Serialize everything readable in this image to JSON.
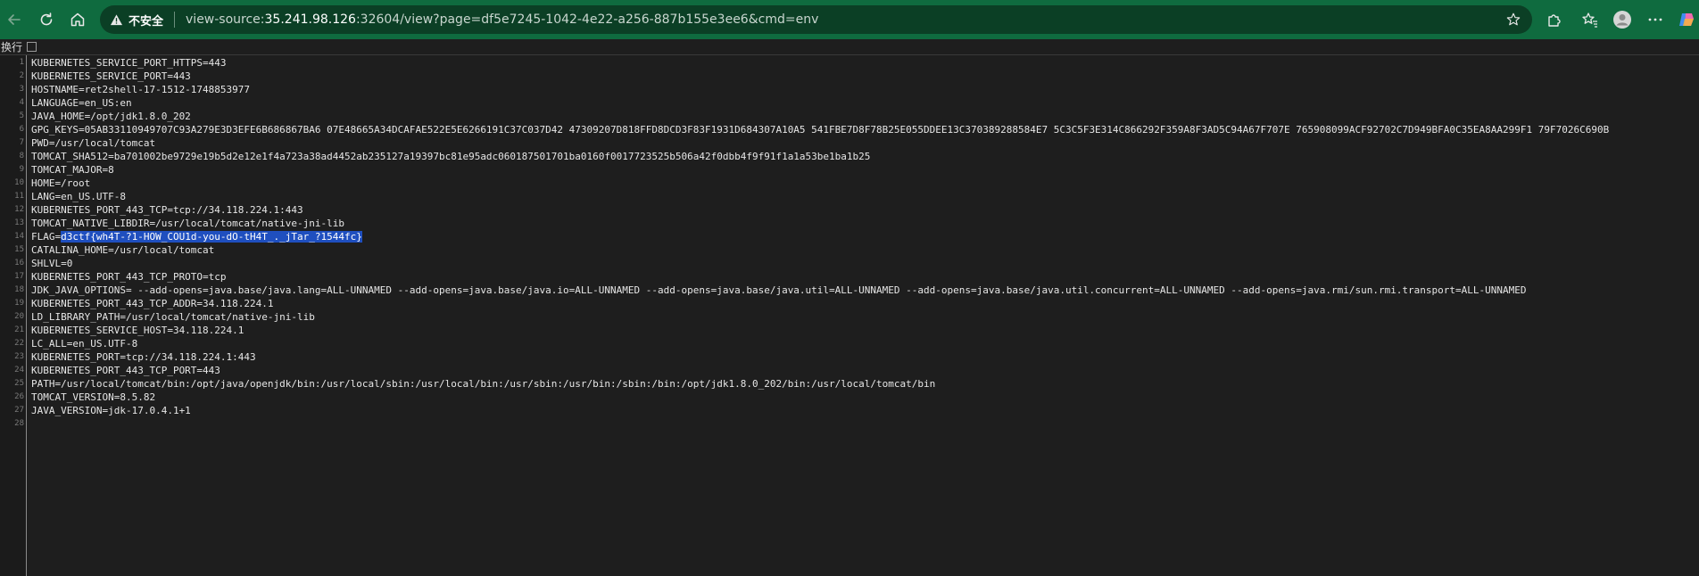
{
  "browser": {
    "insecure_label": "不安全",
    "url_prefix": "view-source:",
    "url_host": "35.241.98.126",
    "url_rest": ":32604/view?page=df5e7245-1042-4e22-a256-887b155e3ee6&cmd=env"
  },
  "wrap": {
    "label": "换行",
    "checked": false
  },
  "lines": [
    {
      "n": "1",
      "text": "KUBERNETES_SERVICE_PORT_HTTPS=443"
    },
    {
      "n": "2",
      "text": "KUBERNETES_SERVICE_PORT=443"
    },
    {
      "n": "3",
      "text": "HOSTNAME=ret2shell-17-1512-1748853977"
    },
    {
      "n": "4",
      "text": "LANGUAGE=en_US:en"
    },
    {
      "n": "5",
      "text": "JAVA_HOME=/opt/jdk1.8.0_202"
    },
    {
      "n": "6",
      "text": "GPG_KEYS=05AB33110949707C93A279E3D3EFE6B686867BA6 07E48665A34DCAFAE522E5E6266191C37C037D42 47309207D818FFD8DCD3F83F1931D684307A10A5 541FBE7D8F78B25E055DDEE13C370389288584E7 5C3C5F3E314C866292F359A8F3AD5C94A67F707E 765908099ACF92702C7D949BFA0C35EA8AA299F1 79F7026C690B"
    },
    {
      "n": "7",
      "text": "PWD=/usr/local/tomcat"
    },
    {
      "n": "8",
      "text": "TOMCAT_SHA512=ba701002be9729e19b5d2e12e1f4a723a38ad4452ab235127a19397bc81e95adc060187501701ba0160f0017723525b506a42f0dbb4f9f91f1a1a53be1ba1b25"
    },
    {
      "n": "9",
      "text": "TOMCAT_MAJOR=8"
    },
    {
      "n": "10",
      "text": "HOME=/root"
    },
    {
      "n": "11",
      "text": "LANG=en_US.UTF-8"
    },
    {
      "n": "12",
      "text": "KUBERNETES_PORT_443_TCP=tcp://34.118.224.1:443"
    },
    {
      "n": "13",
      "text": "TOMCAT_NATIVE_LIBDIR=/usr/local/tomcat/native-jni-lib"
    },
    {
      "n": "14",
      "text": "FLAG=",
      "highlight": "d3ctf{wh4T-?1-HOW_COU1d-you-dO-tH4T_._jTar_?1544fc}"
    },
    {
      "n": "15",
      "text": "CATALINA_HOME=/usr/local/tomcat"
    },
    {
      "n": "16",
      "text": "SHLVL=0"
    },
    {
      "n": "17",
      "text": "KUBERNETES_PORT_443_TCP_PROTO=tcp"
    },
    {
      "n": "18",
      "text": "JDK_JAVA_OPTIONS= --add-opens=java.base/java.lang=ALL-UNNAMED --add-opens=java.base/java.io=ALL-UNNAMED --add-opens=java.base/java.util=ALL-UNNAMED --add-opens=java.base/java.util.concurrent=ALL-UNNAMED --add-opens=java.rmi/sun.rmi.transport=ALL-UNNAMED"
    },
    {
      "n": "19",
      "text": "KUBERNETES_PORT_443_TCP_ADDR=34.118.224.1"
    },
    {
      "n": "20",
      "text": "LD_LIBRARY_PATH=/usr/local/tomcat/native-jni-lib"
    },
    {
      "n": "21",
      "text": "KUBERNETES_SERVICE_HOST=34.118.224.1"
    },
    {
      "n": "22",
      "text": "LC_ALL=en_US.UTF-8"
    },
    {
      "n": "23",
      "text": "KUBERNETES_PORT=tcp://34.118.224.1:443"
    },
    {
      "n": "24",
      "text": "KUBERNETES_PORT_443_TCP_PORT=443"
    },
    {
      "n": "25",
      "text": "PATH=/usr/local/tomcat/bin:/opt/java/openjdk/bin:/usr/local/sbin:/usr/local/bin:/usr/sbin:/usr/bin:/sbin:/bin:/opt/jdk1.8.0_202/bin:/usr/local/tomcat/bin"
    },
    {
      "n": "26",
      "text": "TOMCAT_VERSION=8.5.82"
    },
    {
      "n": "27",
      "text": "JAVA_VERSION=jdk-17.0.4.1+1"
    },
    {
      "n": "28",
      "text": ""
    }
  ]
}
